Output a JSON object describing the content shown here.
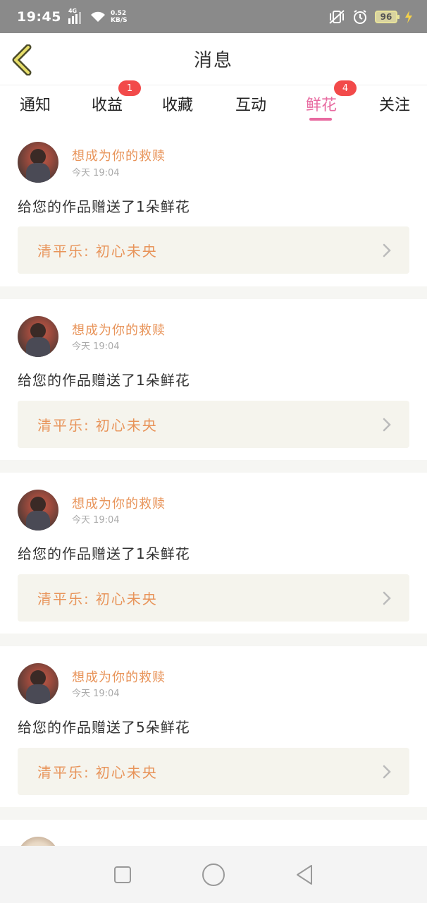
{
  "status_bar": {
    "time": "19:45",
    "network": "4G",
    "speed_value": "0.52",
    "speed_unit": "KB/S",
    "battery": "96"
  },
  "header": {
    "title": "消息"
  },
  "tabs": [
    {
      "label": "通知",
      "badge": null,
      "active": false
    },
    {
      "label": "收益",
      "badge": "1",
      "active": false
    },
    {
      "label": "收藏",
      "badge": null,
      "active": false
    },
    {
      "label": "互动",
      "badge": null,
      "active": false
    },
    {
      "label": "鲜花",
      "badge": "4",
      "active": true
    },
    {
      "label": "关注",
      "badge": null,
      "active": false
    }
  ],
  "messages": [
    {
      "sender": "想成为你的救赎",
      "time": "今天 19:04",
      "content": "给您的作品赠送了1朵鲜花",
      "work_label": "清平乐:",
      "work_title": "初心未央"
    },
    {
      "sender": "想成为你的救赎",
      "time": "今天 19:04",
      "content": "给您的作品赠送了1朵鲜花",
      "work_label": "清平乐:",
      "work_title": "初心未央"
    },
    {
      "sender": "想成为你的救赎",
      "time": "今天 19:04",
      "content": "给您的作品赠送了1朵鲜花",
      "work_label": "清平乐:",
      "work_title": "初心未央"
    },
    {
      "sender": "想成为你的救赎",
      "time": "今天 19:04",
      "content": "给您的作品赠送了5朵鲜花",
      "work_label": "清平乐:",
      "work_title": "初心未央"
    }
  ],
  "colors": {
    "accent_pink": "#e86aa0",
    "accent_orange": "#e8945a",
    "badge_red": "#f24a4a"
  }
}
